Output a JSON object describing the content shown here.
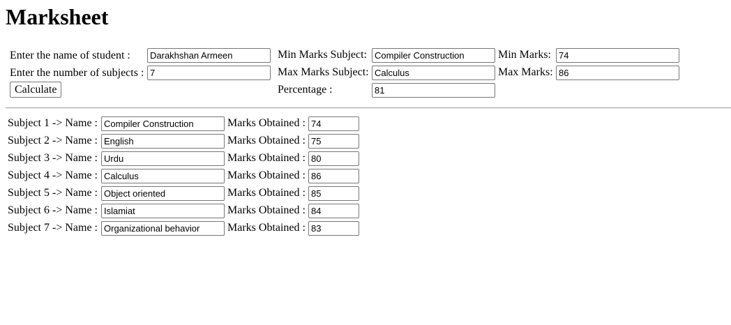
{
  "page": {
    "title": "Marksheet"
  },
  "form": {
    "student_label": "Enter the name of student :",
    "student_value": "Darakhshan Armeen",
    "subjects_label": "Enter the number of subjects :",
    "subjects_value": "7",
    "calculate_label": "Calculate"
  },
  "summary": {
    "min_subject_label": "Min Marks Subject:",
    "min_subject_value": "Compiler Construction",
    "min_marks_label": "Min Marks:",
    "min_marks_value": "74",
    "max_subject_label": "Max Marks Subject:",
    "max_subject_value": "Calculus",
    "max_marks_label": "Max Marks:",
    "max_marks_value": "86",
    "percentage_label": "Percentage :",
    "percentage_value": "81"
  },
  "subjects": [
    {
      "label": "Subject 1 -> Name :",
      "name": "Compiler Construction",
      "marks_label": "Marks Obtained :",
      "marks": "74"
    },
    {
      "label": "Subject 2 -> Name :",
      "name": "English",
      "marks_label": "Marks Obtained :",
      "marks": "75"
    },
    {
      "label": "Subject 3 -> Name :",
      "name": "Urdu",
      "marks_label": "Marks Obtained :",
      "marks": "80"
    },
    {
      "label": "Subject 4 -> Name :",
      "name": "Calculus",
      "marks_label": "Marks Obtained :",
      "marks": "86"
    },
    {
      "label": "Subject 5 -> Name :",
      "name": "Object oriented",
      "marks_label": "Marks Obtained :",
      "marks": "85"
    },
    {
      "label": "Subject 6 -> Name :",
      "name": "Islamiat",
      "marks_label": "Marks Obtained :",
      "marks": "84"
    },
    {
      "label": "Subject 7 -> Name :",
      "name": "Organizational behavior",
      "marks_label": "Marks Obtained :",
      "marks": "83"
    }
  ]
}
